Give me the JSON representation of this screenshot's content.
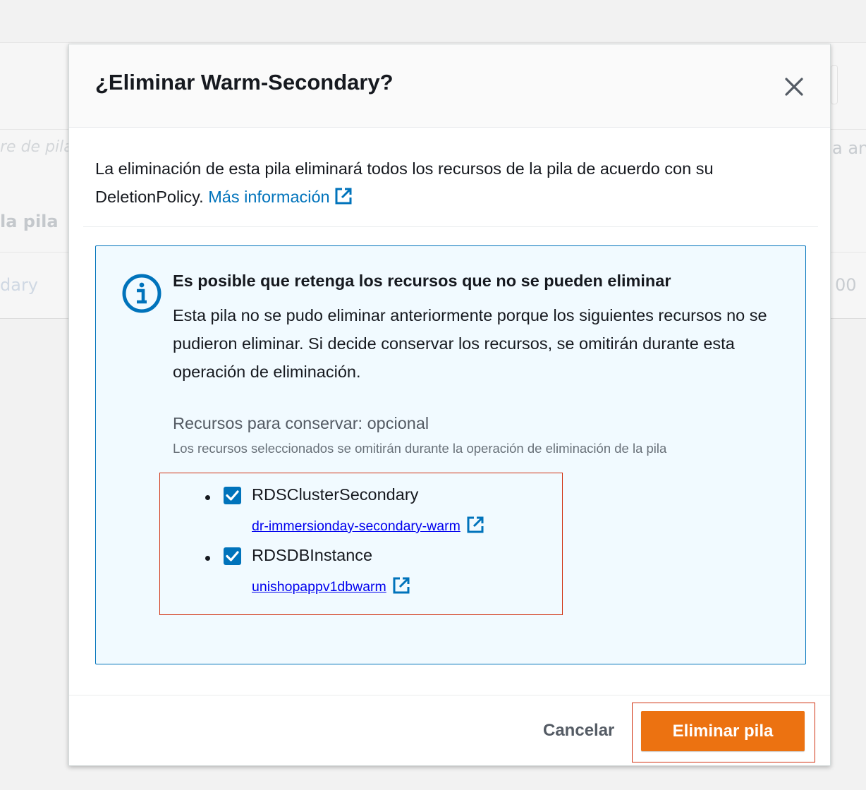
{
  "background": {
    "fragments": {
      "search_placeholder": "re de pila",
      "column_header": "la pila",
      "stack_name": "dary",
      "right_filter": "a anid",
      "right_value": "00"
    }
  },
  "modal": {
    "title": "¿Eliminar Warm-Secondary?",
    "close_label": "Cerrar",
    "intro_text": "La eliminación de esta pila eliminará todos los recursos de la pila de acuerdo con su DeletionPolicy.",
    "learn_more_label": "Más información",
    "alert": {
      "title": "Es posible que retenga los recursos que no se pueden eliminar",
      "body": "Esta pila no se pudo eliminar anteriormente porque los siguientes recursos no se pudieron eliminar. Si decide conservar los recursos, se omitirán durante esta operación de eliminación.",
      "field_label": "Recursos para conservar: opcional",
      "field_description": "Los recursos seleccionados se omitirán durante la operación de eliminación de la pila",
      "resources": [
        {
          "name": "RDSClusterSecondary",
          "link": "dr-immersionday-secondary-warm",
          "checked": true
        },
        {
          "name": "RDSDBInstance",
          "link": "unishopappv1dbwarm",
          "checked": true
        }
      ]
    },
    "footer": {
      "cancel_label": "Cancelar",
      "delete_label": "Eliminar pila"
    }
  },
  "colors": {
    "primary_button": "#ec7211",
    "link": "#0073bb",
    "resource_link": "#0000ee",
    "info_border": "#0073bb",
    "info_background": "#f1faff",
    "highlight_outline": "#d13212"
  },
  "icons": {
    "close": "close-icon",
    "external_link": "external-link-icon",
    "info": "info-icon",
    "checkbox": "checkbox-checked-icon"
  }
}
